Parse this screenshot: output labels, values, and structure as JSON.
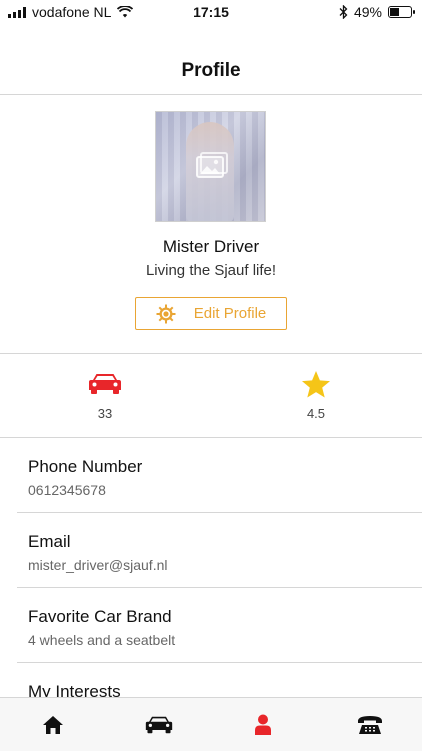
{
  "status_bar": {
    "carrier": "vodafone NL",
    "time": "17:15",
    "battery": "49%",
    "battery_level": 0.49
  },
  "nav": {
    "title": "Profile"
  },
  "profile": {
    "name": "Mister Driver",
    "tagline": "Living the Sjauf life!",
    "edit_label": "Edit Profile"
  },
  "stats": [
    {
      "icon": "car-icon",
      "value": "33",
      "color": "#e8262a"
    },
    {
      "icon": "star-icon",
      "value": "4.5",
      "color": "#f5c518"
    }
  ],
  "details": [
    {
      "label": "Phone Number",
      "value": "0612345678"
    },
    {
      "label": "Email",
      "value": "mister_driver@sjauf.nl"
    },
    {
      "label": "Favorite Car Brand",
      "value": "4 wheels and a seatbelt"
    },
    {
      "label": "My Interests",
      "value": ""
    }
  ],
  "tabs": [
    {
      "icon": "home-icon",
      "active": false
    },
    {
      "icon": "car-icon",
      "active": false
    },
    {
      "icon": "person-icon",
      "active": true
    },
    {
      "icon": "telephone-icon",
      "active": false
    }
  ],
  "colors": {
    "accent": "#e9a534",
    "active_tab": "#e8262a",
    "inactive_tab": "#111111"
  }
}
